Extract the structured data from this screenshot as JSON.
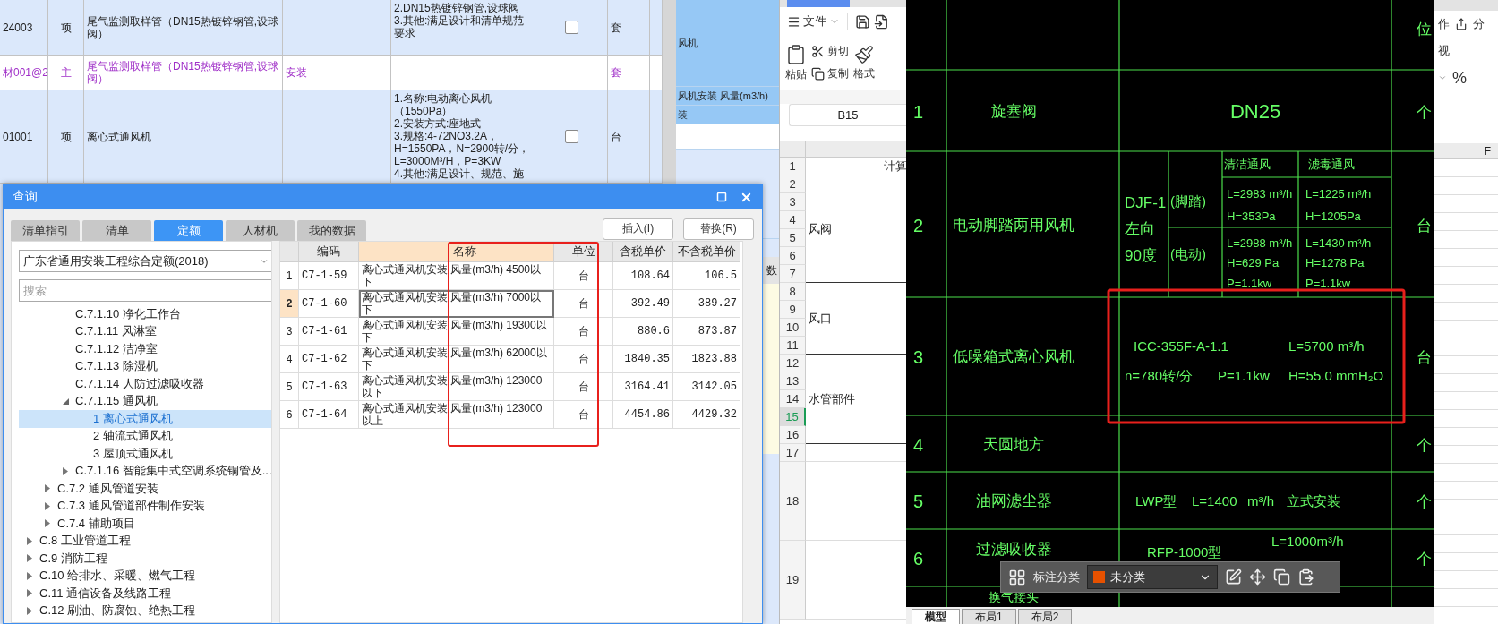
{
  "background_table": {
    "rows": [
      {
        "kind": "item",
        "code": "24003",
        "type": "项",
        "name": "尾气监测取样管（DN15热镀锌钢管,设球阀）",
        "features": [
          "2.DN15热镀锌钢管,设球阀",
          "3.其他:满足设计和清单规范要求"
        ],
        "checked": false,
        "unit": "套"
      },
      {
        "kind": "material",
        "code": "材001@2",
        "type": "主",
        "name": "尾气监测取样管（DN15热镀锌钢管,设球阀）",
        "column_4": "安装",
        "unit": "套"
      },
      {
        "kind": "item",
        "code": "01001",
        "type": "项",
        "name": "离心式通风机",
        "features": [
          "1.名称:电动离心风机（1550Pa）",
          "2.安装方式:座地式",
          "3.规格:4-72NO3.2A，H=1550PA，N=2900转/分，L=3000M³/H，P=3KW",
          "4.其他:满足设计、规范、施"
        ],
        "checked": false,
        "unit": "台"
      }
    ]
  },
  "side_panel": {
    "texts": [
      "风机",
      "风机安装 风量(m3/h)",
      "装"
    ],
    "header": "数"
  },
  "dialog": {
    "title": "查询",
    "tabs": [
      {
        "label": "清单指引",
        "selected": false
      },
      {
        "label": "清单",
        "selected": false
      },
      {
        "label": "定额",
        "selected": true
      },
      {
        "label": "人材机",
        "selected": false
      },
      {
        "label": "我的数据",
        "selected": false
      }
    ],
    "buttons": [
      "插入(I)",
      "替换(R)"
    ],
    "library": "广东省通用安装工程综合定额(2018)",
    "search_placeholder": "搜索",
    "tree": [
      {
        "children": [
          {
            "children": [
              {
                "label": "C.7.1.10 净化工作台",
                "selected": false
              },
              {
                "label": "C.7.1.11 风淋室",
                "selected": false
              },
              {
                "label": "C.7.1.12 洁净室",
                "selected": false
              },
              {
                "label": "C.7.1.13 除湿机",
                "selected": false
              },
              {
                "label": "C.7.1.14 人防过滤吸收器",
                "selected": false
              },
              {
                "label": "C.7.1.15 通风机",
                "selected": false,
                "expanded": true,
                "children": [
                  {
                    "label": "1 离心式通风机",
                    "selected": true
                  },
                  {
                    "label": "2 轴流式通风机",
                    "selected": false
                  },
                  {
                    "label": "3 屋顶式通风机",
                    "selected": false
                  }
                ]
              },
              {
                "label": "C.7.1.16 智能集中式空调系统铜管及...",
                "selected": false,
                "expanded": false
              }
            ]
          },
          {
            "label": "C.7.2 通风管道安装",
            "selected": false,
            "expanded": false
          },
          {
            "label": "C.7.3 通风管道部件制作安装",
            "selected": false,
            "expanded": false
          },
          {
            "label": "C.7.4 辅助项目",
            "selected": false,
            "expanded": false
          }
        ]
      },
      {
        "label": "C.8 工业管道工程",
        "selected": false,
        "expanded": false
      },
      {
        "label": "C.9 消防工程",
        "selected": false,
        "expanded": false
      },
      {
        "label": "C.10 给排水、采暖、燃气工程",
        "selected": false,
        "expanded": false
      },
      {
        "label": "C.11 通信设备及线路工程",
        "selected": false,
        "expanded": false
      },
      {
        "label": "C.12 刷油、防腐蚀、绝热工程",
        "selected": false,
        "expanded": false
      }
    ],
    "table": {
      "columns": [
        {
          "label": "编码",
          "selected": false
        },
        {
          "label": "名称",
          "selected": true
        },
        {
          "label": "单位",
          "selected": false
        },
        {
          "label": "含税单价",
          "selected": false
        },
        {
          "label": "不含税单价",
          "selected": false
        }
      ],
      "rows": [
        {
          "number": "1",
          "code": "C7-1-59",
          "name": "离心式通风机安装 风量(m3/h) 4500以下",
          "unit": "台",
          "price_tax": "108.64",
          "price_no_tax": "106.5",
          "selected": false
        },
        {
          "number": "2",
          "code": "C7-1-60",
          "name": "离心式通风机安装 风量(m3/h) 7000以下",
          "unit": "台",
          "price_tax": "392.49",
          "price_no_tax": "389.27",
          "selected": true
        },
        {
          "number": "3",
          "code": "C7-1-61",
          "name": "离心式通风机安装 风量(m3/h) 19300以下",
          "unit": "台",
          "price_tax": "880.6",
          "price_no_tax": "873.87",
          "selected": false
        },
        {
          "number": "4",
          "code": "C7-1-62",
          "name": "离心式通风机安装 风量(m3/h) 62000以下",
          "unit": "台",
          "price_tax": "1840.35",
          "price_no_tax": "1823.88",
          "selected": false
        },
        {
          "number": "5",
          "code": "C7-1-63",
          "name": "离心式通风机安装 风量(m3/h) 123000以下",
          "unit": "台",
          "price_tax": "3164.41",
          "price_no_tax": "3142.05",
          "selected": false
        },
        {
          "number": "6",
          "code": "C7-1-64",
          "name": "离心式通风机安装 风量(m3/h) 123000以上",
          "unit": "台",
          "price_tax": "4454.86",
          "price_no_tax": "4429.32",
          "selected": false
        }
      ]
    }
  },
  "spreadsheet": {
    "menu": "文件",
    "paste": "粘贴",
    "cut": "剪切",
    "copy": "复制",
    "format": "格式",
    "cell_ref": "B15",
    "blocks": [
      {
        "text": "计算",
        "kind": "header",
        "rows": [
          {
            "label": "1",
            "selected": false
          }
        ]
      },
      {
        "text": "风阀",
        "rows": [
          {
            "label": "2",
            "selected": false
          },
          {
            "label": "3",
            "selected": false
          },
          {
            "label": "4",
            "selected": false
          },
          {
            "label": "5",
            "selected": false
          },
          {
            "label": "6",
            "selected": false
          },
          {
            "label": "7",
            "selected": false
          }
        ]
      },
      {
        "text": "风口",
        "rows": [
          {
            "label": "8",
            "selected": false
          },
          {
            "label": "9",
            "selected": false
          },
          {
            "label": "10",
            "selected": false
          },
          {
            "label": "11",
            "selected": false
          }
        ]
      },
      {
        "text": "水管部件",
        "rows": [
          {
            "label": "12",
            "selected": false
          },
          {
            "label": "13",
            "selected": false
          },
          {
            "label": "14",
            "selected": false
          },
          {
            "label": "15",
            "selected": true
          },
          {
            "label": "16",
            "selected": false
          }
        ]
      },
      {
        "rows": [
          {
            "label": "17",
            "selected": false
          }
        ]
      },
      {
        "rows": [
          {
            "label": "18",
            "selected": false
          }
        ]
      },
      {
        "rows": [
          {
            "label": "19",
            "selected": false
          }
        ]
      }
    ]
  },
  "cad": {
    "header_unit": "位",
    "rows": [
      {
        "kind": "simple",
        "number": "1",
        "name": "旋塞阀",
        "spec": [
          "DN25"
        ],
        "unit": "个"
      },
      {
        "kind": "dual",
        "number": "2",
        "name": "电动脚踏两用风机",
        "model": [
          "DJF-1",
          "左向",
          "90度"
        ],
        "headers": [
          "清洁通风",
          "滤毒通风"
        ],
        "modes": [
          {
            "mode": "(脚踏)",
            "values": [
              [
                "L=2983 m³/h",
                "H=353Pa"
              ],
              [
                "L=1225 m³/h",
                "H=1205Pa"
              ]
            ]
          },
          {
            "mode": "(电动)",
            "values": [
              [
                "L=2988 m³/h",
                "H=629 Pa",
                "P=1.1kw"
              ],
              [
                "L=1430 m³/h",
                "H=1278 Pa",
                "P=1.1kw"
              ]
            ]
          }
        ],
        "unit": "台"
      },
      {
        "kind": "grid",
        "number": "3",
        "name": "低噪箱式离心风机",
        "spec": [
          "ICC-355F-A-1.1",
          "L=5700 m³/h",
          "n=780转/分",
          "P=1.1kw",
          "H=55.0 mmH₂O"
        ],
        "unit": "台"
      },
      {
        "kind": "simple",
        "number": "4",
        "name": "天圆地方",
        "unit": "个"
      },
      {
        "kind": "inline",
        "number": "5",
        "name": "油网滤尘器",
        "spec": [
          "LWP型",
          "L=1400",
          "m³/h",
          "立式安装"
        ],
        "unit": "个"
      },
      {
        "kind": "stacked",
        "number": "6",
        "name": "过滤吸收器",
        "spec": [
          "RFP-1000型",
          "L=1000m³/h"
        ],
        "unit": "个"
      },
      {
        "kind": "partial",
        "name": "换气接头"
      }
    ],
    "tabs": [
      {
        "label": "模型",
        "selected": true
      },
      {
        "label": "布局1",
        "selected": false
      },
      {
        "label": "布局2",
        "selected": false
      }
    ]
  },
  "annotation_toolbar": {
    "label": "标注分类",
    "category": "未分类"
  },
  "right_pane": {
    "top": [
      "作",
      "分"
    ],
    "view": "视",
    "percent": "%",
    "column": "F"
  }
}
